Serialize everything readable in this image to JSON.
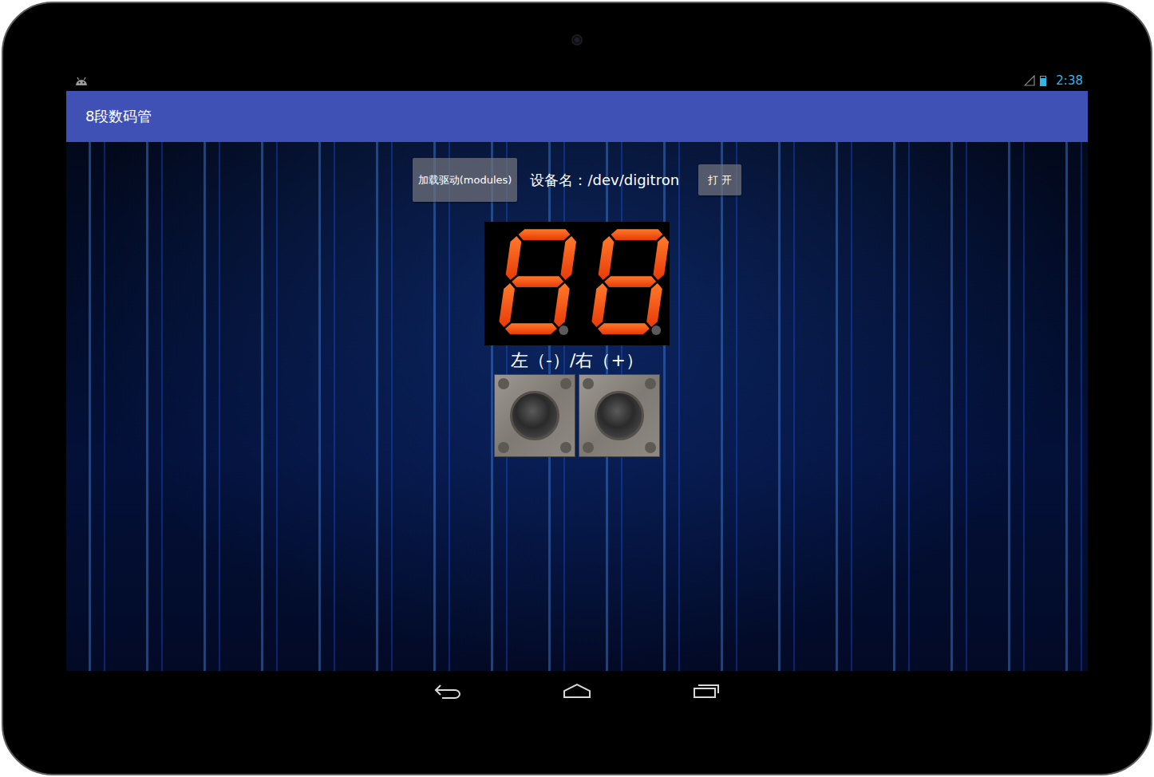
{
  "status_bar": {
    "time": "2:38",
    "battery_level": 0.8
  },
  "window": {
    "title": "8段数码管"
  },
  "toolbar": {
    "load_button": "加载驱动(modules)",
    "device_label": "设备名：/dev/digitron",
    "open_button": "打 开"
  },
  "display": {
    "digits": [
      {
        "segments": [
          "a",
          "b",
          "c",
          "d",
          "e",
          "f",
          "g"
        ],
        "dot": false
      },
      {
        "segments": [
          "a",
          "b",
          "c",
          "d",
          "e",
          "f",
          "g"
        ],
        "dot": false
      }
    ]
  },
  "keys": {
    "label": "左（-）/右（+）",
    "buttons": [
      {
        "pressed": false
      },
      {
        "pressed": false
      }
    ]
  }
}
